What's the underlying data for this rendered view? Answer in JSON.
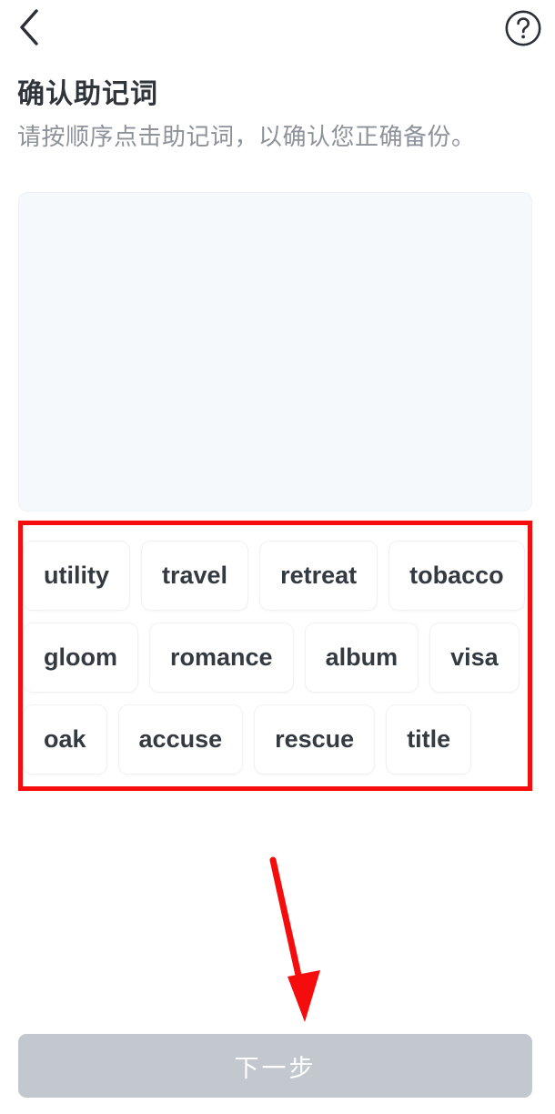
{
  "topbar": {
    "back_icon": "chevron-left-icon",
    "help_icon": "question-circle-icon"
  },
  "header": {
    "title": "确认助记词",
    "subtitle": "请按顺序点击助记词，以确认您正确备份。"
  },
  "answer_panel": {
    "selected_words": [],
    "background_color": "#f5f9fc"
  },
  "word_bank": {
    "words": [
      "utility",
      "travel",
      "retreat",
      "tobacco",
      "gloom",
      "romance",
      "album",
      "visa",
      "oak",
      "accuse",
      "rescue",
      "title"
    ]
  },
  "footer": {
    "next_label": "下一步",
    "next_enabled": false,
    "next_color": "#c3c8cf"
  },
  "annotations": {
    "highlight_color": "#f50d0d",
    "box_target": "word-bank",
    "arrow_target": "next-button"
  }
}
